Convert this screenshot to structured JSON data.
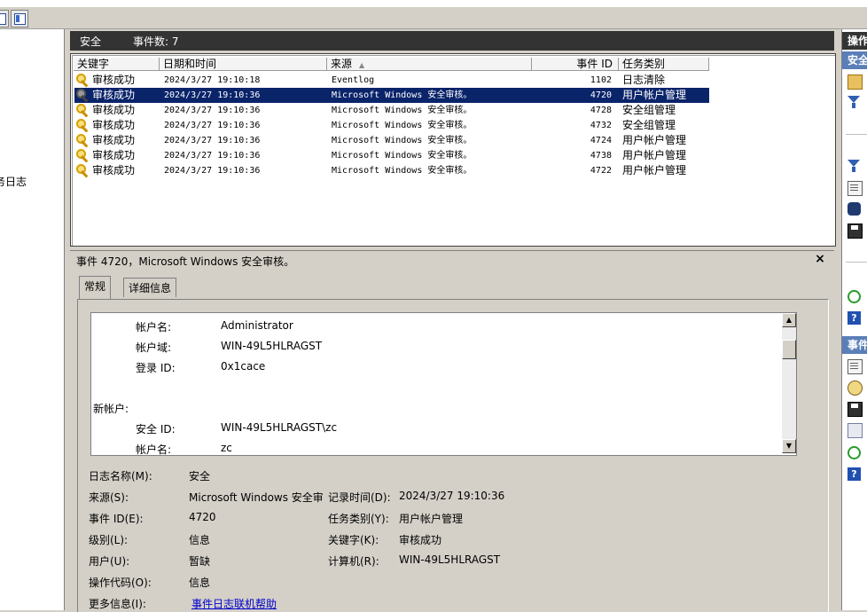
{
  "left_tree": {
    "item_top": ")",
    "item_log": "务日志"
  },
  "log_header": {
    "title": "安全",
    "event_count": "事件数: 7"
  },
  "columns": [
    "关键字",
    "日期和时间",
    "来源",
    "事件 ID",
    "任务类别"
  ],
  "events": [
    {
      "keyword": "审核成功",
      "datetime": "2024/3/27 19:10:18",
      "source": "Eventlog",
      "event_id": "1102",
      "category": "日志清除",
      "selected": false
    },
    {
      "keyword": "审核成功",
      "datetime": "2024/3/27 19:10:36",
      "source": "Microsoft Windows 安全审核。",
      "event_id": "4720",
      "category": "用户帐户管理",
      "selected": true
    },
    {
      "keyword": "审核成功",
      "datetime": "2024/3/27 19:10:36",
      "source": "Microsoft Windows 安全审核。",
      "event_id": "4728",
      "category": "安全组管理",
      "selected": false
    },
    {
      "keyword": "审核成功",
      "datetime": "2024/3/27 19:10:36",
      "source": "Microsoft Windows 安全审核。",
      "event_id": "4732",
      "category": "安全组管理",
      "selected": false
    },
    {
      "keyword": "审核成功",
      "datetime": "2024/3/27 19:10:36",
      "source": "Microsoft Windows 安全审核。",
      "event_id": "4724",
      "category": "用户帐户管理",
      "selected": false
    },
    {
      "keyword": "审核成功",
      "datetime": "2024/3/27 19:10:36",
      "source": "Microsoft Windows 安全审核。",
      "event_id": "4738",
      "category": "用户帐户管理",
      "selected": false
    },
    {
      "keyword": "审核成功",
      "datetime": "2024/3/27 19:10:36",
      "source": "Microsoft Windows 安全审核。",
      "event_id": "4722",
      "category": "用户帐户管理",
      "selected": false
    }
  ],
  "detail": {
    "title": "事件 4720，Microsoft Windows 安全审核。",
    "close": "×",
    "tabs": [
      "常规",
      "详细信息"
    ],
    "description": {
      "l1_label": "帐户名:",
      "l1_value": "Administrator",
      "l2_label": "帐户域:",
      "l2_value": "WIN-49L5HLRAGST",
      "l3_label": "登录 ID:",
      "l3_value": "0x1cace",
      "section": "新帐户:",
      "l4_label": "安全 ID:",
      "l4_value": "WIN-49L5HLRAGST\\zc",
      "l5_label": "帐户名:",
      "l5_value": "zc"
    },
    "props": {
      "log_name_label": "日志名称(M):",
      "log_name": "安全",
      "source_label": "来源(S):",
      "source": "Microsoft Windows 安全审",
      "recorded_label": "记录时间(D):",
      "recorded": "2024/3/27 19:10:36",
      "event_id_label": "事件 ID(E):",
      "event_id": "4720",
      "task_label": "任务类别(Y):",
      "task": "用户帐户管理",
      "level_label": "级别(L):",
      "level": "信息",
      "keywords_label": "关键字(K):",
      "keywords": "审核成功",
      "user_label": "用户(U):",
      "user": "暂缺",
      "computer_label": "计算机(R):",
      "computer": "WIN-49L5HLRAGST",
      "opcode_label": "操作代码(O):",
      "opcode": "信息",
      "moreinfo_label": "更多信息(I):",
      "moreinfo_link": "事件日志联机帮助"
    }
  },
  "actions": {
    "header": "操作",
    "sub1": "安全",
    "sub2": "事件"
  },
  "colors": {
    "selection": "#0a246a",
    "header_bg": "#333333",
    "link": "#0000cc"
  }
}
